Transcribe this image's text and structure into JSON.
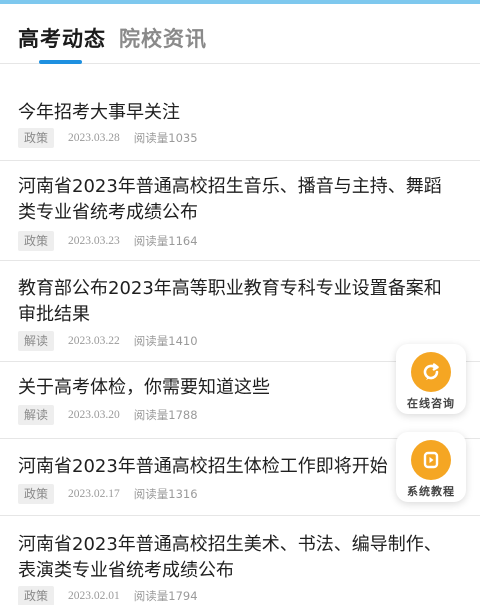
{
  "tabs": [
    {
      "label": "高考动态",
      "active": true
    },
    {
      "label": "院校资讯",
      "active": false
    }
  ],
  "accent_color": "#1e90e0",
  "float_buttons": {
    "consult": {
      "label": "在线咨询",
      "icon": "refresh-chat-icon",
      "color": "#f5a623"
    },
    "tutorial": {
      "label": "系统教程",
      "icon": "play-icon",
      "color": "#f5a623"
    }
  },
  "articles": [
    {
      "title": "今年招考大事早关注",
      "tag": "政策",
      "date": "2023.03.28",
      "views": "阅读量1035"
    },
    {
      "title": "河南省2023年普通高校招生音乐、播音与主持、舞蹈类专业省统考成绩公布",
      "tag": "政策",
      "date": "2023.03.23",
      "views": "阅读量1164"
    },
    {
      "title": "教育部公布2023年高等职业教育专科专业设置备案和审批结果",
      "tag": "解读",
      "date": "2023.03.22",
      "views": "阅读量1410"
    },
    {
      "title": "关于高考体检，你需要知道这些",
      "tag": "解读",
      "date": "2023.03.20",
      "views": "阅读量1788"
    },
    {
      "title": "河南省2023年普通高校招生体检工作即将开始",
      "tag": "政策",
      "date": "2023.02.17",
      "views": "阅读量1316"
    },
    {
      "title": "河南省2023年普通高校招生美术、书法、编导制作、表演类专业省统考成绩公布",
      "tag": "政策",
      "date": "2023.02.01",
      "views": "阅读量1794"
    }
  ]
}
